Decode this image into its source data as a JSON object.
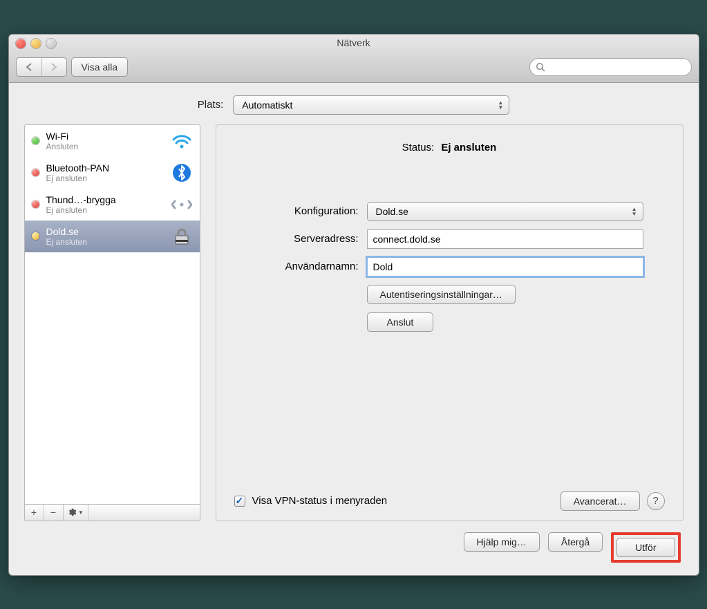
{
  "window": {
    "title": "Nätverk"
  },
  "toolbar": {
    "show_all": "Visa alla"
  },
  "location": {
    "label": "Plats:",
    "value": "Automatiskt"
  },
  "services": [
    {
      "name": "Wi-Fi",
      "status": "Ansluten",
      "dot": "green",
      "icon": "wifi"
    },
    {
      "name": "Bluetooth-PAN",
      "status": "Ej ansluten",
      "dot": "red",
      "icon": "bluetooth"
    },
    {
      "name": "Thund…-brygga",
      "status": "Ej ansluten",
      "dot": "red",
      "icon": "bridge"
    },
    {
      "name": "Dold.se",
      "status": "Ej ansluten",
      "dot": "yellow",
      "icon": "vpn"
    }
  ],
  "detail": {
    "status_label": "Status:",
    "status_value": "Ej ansluten",
    "config_label": "Konfiguration:",
    "config_value": "Dold.se",
    "server_label": "Serveradress:",
    "server_value": "connect.dold.se",
    "user_label": "Användarnamn:",
    "user_value": "Dold",
    "auth_btn": "Autentiseringsinställningar…",
    "connect_btn": "Anslut",
    "show_vpn_label": "Visa VPN-status i menyraden",
    "advanced_btn": "Avancerat…"
  },
  "footer": {
    "help": "Hjälp mig…",
    "revert": "Återgå",
    "apply": "Utför"
  }
}
